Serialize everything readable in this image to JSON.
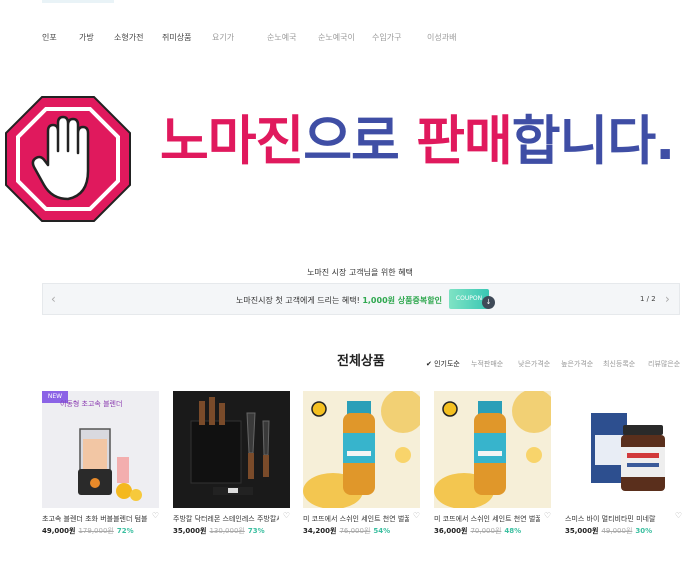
{
  "nav": {
    "items": [
      "인포",
      "가방",
      "소형가전",
      "쥐미상품",
      "요기가",
      "순노예국",
      "순노예국이",
      "수입가구",
      "이성과배"
    ]
  },
  "banner": {
    "headline_part1": "노마진",
    "headline_part2": "으로 ",
    "headline_part3": "판매",
    "headline_part4": "합니다.",
    "colors": {
      "pink": "#e0195d",
      "blue": "#3f4ea5",
      "stop_red": "#e0195d"
    },
    "icon": "stop-hand-icon"
  },
  "benefits": {
    "title": "노마진 시장 고객님을 위한 혜택",
    "coupon_text_prefix": "노마진시장 첫 고객에게 드리는 혜택!",
    "coupon_text_highlight": "1,000원 상품증복할인",
    "coupon_tag": "COUPON",
    "page_indicator": "1 / 2"
  },
  "products_section": {
    "title": "전체상품",
    "sort_options": [
      "인기도순",
      "누적판매순",
      "낮은가격순",
      "높은가격순",
      "최신등록순",
      "리뷰많은순"
    ],
    "active_sort": "인기도순",
    "products": [
      {
        "name": "초고속 블렌더 초화 버블블렌더 텀블러",
        "price": "49,000원",
        "orig": "179,000원",
        "disc": "72%",
        "badge": "NEW",
        "caption": "이동형 초고속 블렌더",
        "image": "blender"
      },
      {
        "name": "주방칼 닥터레몬 스테인레스 주방칼세트",
        "price": "35,000원",
        "orig": "130,000원",
        "disc": "73%",
        "image": "knives"
      },
      {
        "name": "미 코뜨에서 스쉬인 세인트 천연 벌꿀",
        "price": "34,200원",
        "orig": "76,000원",
        "disc": "54%",
        "image": "honey"
      },
      {
        "name": "미 코뜨에서 스쉬인 세인트 천연 벌꿀",
        "price": "36,000원",
        "orig": "70,000원",
        "disc": "48%",
        "image": "honey"
      },
      {
        "name": "스미스 바이 멀티비타민 미네랄",
        "price": "35,000원",
        "orig": "49,000원",
        "disc": "30%",
        "image": "supplement"
      }
    ]
  }
}
